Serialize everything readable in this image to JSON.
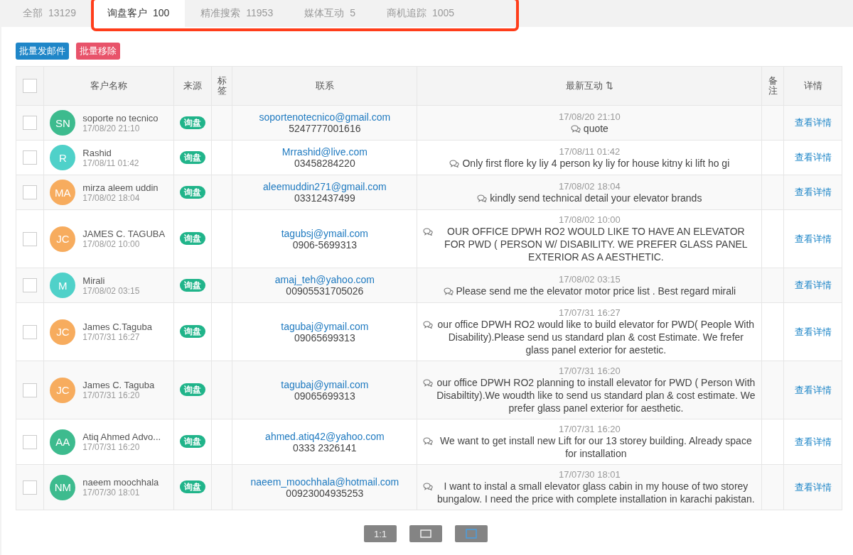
{
  "tabs": [
    {
      "label": "全部",
      "count": "13129",
      "selected": false
    },
    {
      "label": "询盘客户",
      "count": "100",
      "selected": true
    },
    {
      "label": "精准搜索",
      "count": "11953",
      "selected": false
    },
    {
      "label": "媒体互动",
      "count": "5",
      "selected": false
    },
    {
      "label": "商机追踪",
      "count": "1005",
      "selected": false
    }
  ],
  "actions": [
    {
      "label": "批量发邮件",
      "kind": "primary"
    },
    {
      "label": "批量移除",
      "kind": "danger"
    }
  ],
  "table": {
    "columns": [
      "客户名称",
      "来源",
      "标签",
      "联系",
      "最新互动",
      "备注",
      "详情"
    ],
    "sort_icon": "⇅",
    "select_all": false,
    "rows": [
      {
        "initials": "SN",
        "color": "#3dbb8e",
        "name": "soporte no tecnico",
        "time": "17/08/20 21:10",
        "source": "询盘",
        "email": "soportenotecnico@gmail.com",
        "phone": "5247777001616",
        "msg_time": "17/08/20 21:10",
        "message": "quote",
        "detail": "查看详情",
        "checked": false
      },
      {
        "initials": "R",
        "color": "#4fd1c9",
        "name": "Rashid",
        "time": "17/08/11 01:42",
        "source": "询盘",
        "email": "Mrrashid@live.com",
        "phone": "03458284220",
        "msg_time": "17/08/11 01:42",
        "message": "Only first flore ky liy 4 person ky liy for house kitny ki lift ho gi",
        "detail": "查看详情",
        "checked": false
      },
      {
        "initials": "MA",
        "color": "#f7ac5e",
        "name": "mirza aleem uddin",
        "time": "17/08/02 18:04",
        "source": "询盘",
        "email": "aleemuddin271@gmail.com",
        "phone": "03312437499",
        "msg_time": "17/08/02 18:04",
        "message": "kindly send technical detail your elevator brands",
        "detail": "查看详情",
        "checked": false
      },
      {
        "initials": "JC",
        "color": "#f7ac5e",
        "name": "JAMES C. TAGUBA",
        "time": "17/08/02 10:00",
        "source": "询盘",
        "email": "tagubsj@ymail.com",
        "phone": "0906-5699313",
        "msg_time": "17/08/02 10:00",
        "message": "OUR OFFICE DPWH RO2 WOULD LIKE TO HAVE AN ELEVATOR FOR PWD ( PERSON W/ DISABILITY. WE PREFER GLASS PANEL EXTERIOR AS A AESTHETIC.",
        "detail": "查看详情",
        "checked": false
      },
      {
        "initials": "M",
        "color": "#4fd1c9",
        "name": "Mirali",
        "time": "17/08/02 03:15",
        "source": "询盘",
        "email": "amaj_teh@yahoo.com",
        "phone": "00905531705026",
        "msg_time": "17/08/02 03:15",
        "message": "Please send me the elevator motor price list . Best regard mirali",
        "detail": "查看详情",
        "checked": false
      },
      {
        "initials": "JC",
        "color": "#f7ac5e",
        "name": "James C.Taguba",
        "time": "17/07/31 16:27",
        "source": "询盘",
        "email": "tagubaj@ymail.com",
        "phone": "09065699313",
        "msg_time": "17/07/31 16:27",
        "message": "our office DPWH RO2 would like to build elevator for PWD( People With Disability).Please send us standard plan & cost Estimate. We frefer glass panel exterior for aestetic.",
        "detail": "查看详情",
        "checked": false
      },
      {
        "initials": "JC",
        "color": "#f7ac5e",
        "name": "James C. Taguba",
        "time": "17/07/31 16:20",
        "source": "询盘",
        "email": "tagubaj@ymail.com",
        "phone": "09065699313",
        "msg_time": "17/07/31 16:20",
        "message": "our office DPWH RO2 planning to install elevator for PWD ( Person With Disabiltity).We woudth like to send us standard plan & cost estimate. We prefer glass panel exterior for aesthetic.",
        "detail": "查看详情",
        "checked": false
      },
      {
        "initials": "AA",
        "color": "#3dbb8e",
        "name": "Atiq Ahmed Advo...",
        "time": "17/07/31 16:20",
        "source": "询盘",
        "email": "ahmed.atiq42@yahoo.com",
        "phone": "0333 2326141",
        "msg_time": "17/07/31 16:20",
        "message": "We want to get install new Lift for our 13 storey building. Already space for installation",
        "detail": "查看详情",
        "checked": false
      },
      {
        "initials": "NM",
        "color": "#3dbb8e",
        "name": "naeem moochhala",
        "time": "17/07/30 18:01",
        "source": "询盘",
        "email": "naeem_moochhala@hotmail.com",
        "phone": "00923004935253",
        "msg_time": "17/07/30 18:01",
        "message": "I want to instal a small elevator glass cabin in my house of two storey bungalow. I need the price with complete installation in karachi pakistan.",
        "detail": "查看详情",
        "checked": false
      }
    ]
  },
  "viewer_toolbar": {
    "zoom_label": "1:1"
  }
}
